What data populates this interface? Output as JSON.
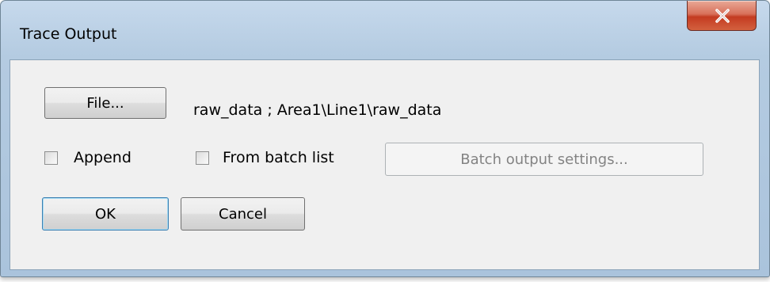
{
  "window": {
    "title": "Trace Output",
    "close_glyph": "X"
  },
  "file": {
    "button_label": "File...",
    "path": "raw_data ; Area1\\Line1\\raw_data"
  },
  "options": {
    "append_label": "Append",
    "append_checked": false,
    "batch_label": "From batch list",
    "batch_checked": false,
    "batch_settings_label": "Batch output settings...",
    "batch_settings_enabled": false
  },
  "actions": {
    "ok_label": "OK",
    "cancel_label": "Cancel"
  },
  "icons": {
    "close": "close-icon"
  },
  "colors": {
    "close_button": "#c43b21",
    "title_bar": "#b4cbe1",
    "client_bg": "#f0f0f0"
  }
}
